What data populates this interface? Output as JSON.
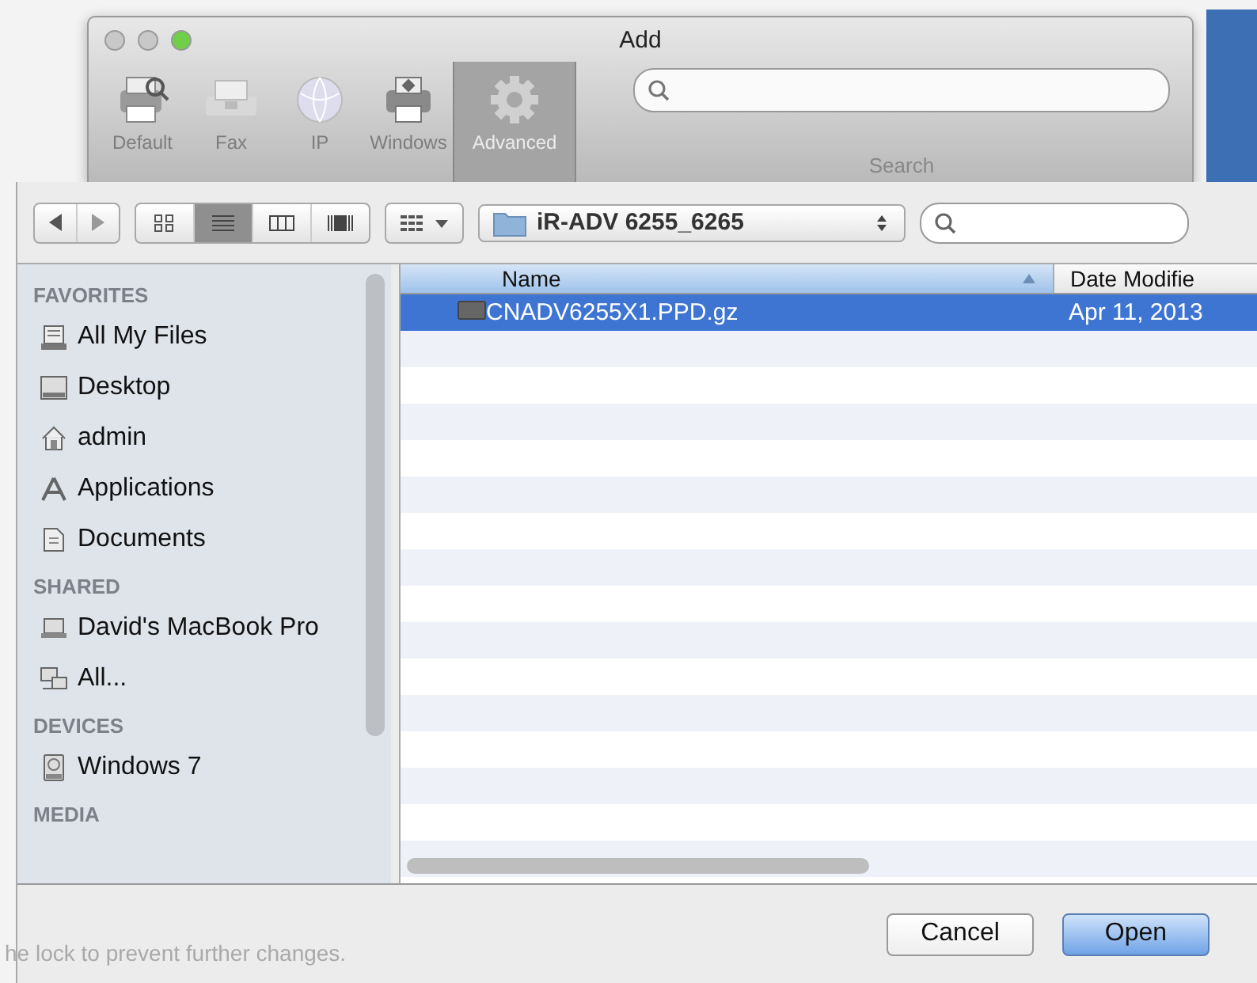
{
  "window": {
    "title": "Add"
  },
  "toolbar": {
    "items": [
      {
        "label": "Default",
        "selected": false
      },
      {
        "label": "Fax",
        "selected": false
      },
      {
        "label": "IP",
        "selected": false
      },
      {
        "label": "Windows",
        "selected": false
      },
      {
        "label": "Advanced",
        "selected": true
      }
    ],
    "search": {
      "label": "Search"
    }
  },
  "sheet": {
    "view_modes": [
      {
        "selected": false
      },
      {
        "selected": true
      },
      {
        "selected": false
      },
      {
        "selected": false
      }
    ],
    "path": "iR-ADV 6255_6265",
    "sidebar": [
      {
        "heading": "FAVORITES",
        "items": [
          "All My Files",
          "Desktop",
          "admin",
          "Applications",
          "Documents"
        ]
      },
      {
        "heading": "SHARED",
        "items": [
          "David's MacBook Pro",
          "All..."
        ]
      },
      {
        "heading": "DEVICES",
        "items": [
          "Windows 7"
        ]
      },
      {
        "heading": "MEDIA"
      }
    ],
    "columns": [
      "Name",
      "Date Modifie"
    ],
    "rows": [
      {
        "name": "CNADV6255X1.PPD.gz",
        "date": "Apr 11, 2013",
        "selected": true
      }
    ],
    "buttons": [
      {
        "label": "Cancel",
        "default": false
      },
      {
        "label": "Open",
        "default": true
      }
    ]
  },
  "background_text": "he lock to prevent further changes."
}
